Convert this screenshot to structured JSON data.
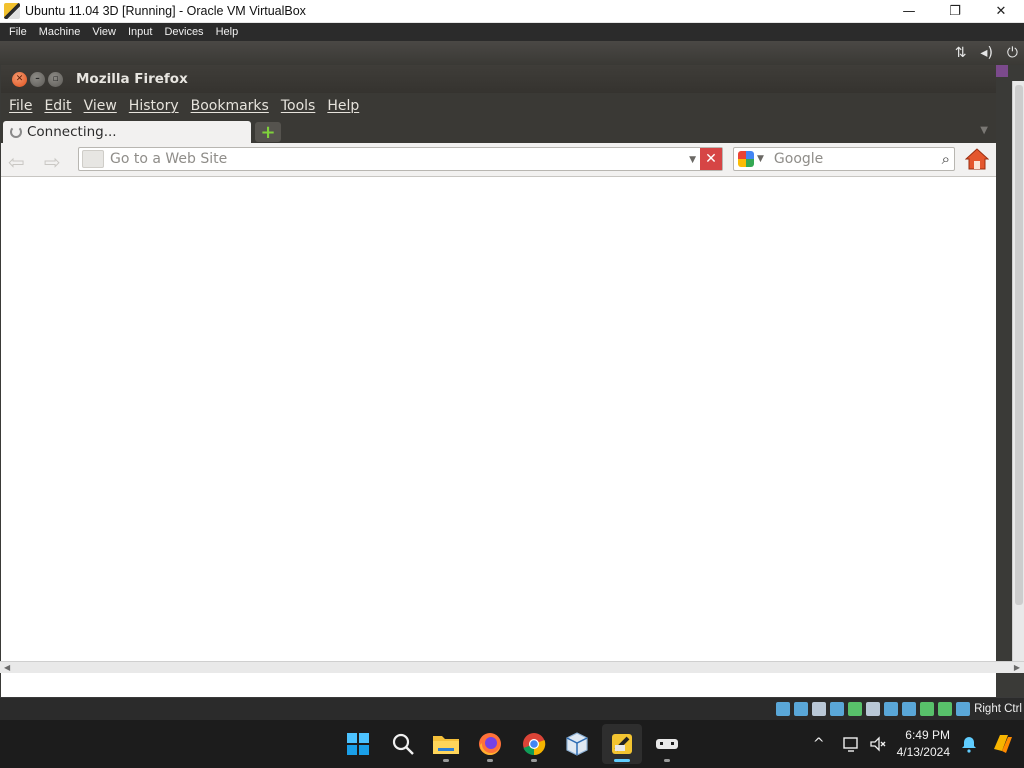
{
  "vbox": {
    "title": "Ubuntu 11.04 3D [Running] - Oracle VM VirtualBox",
    "menu": [
      "File",
      "Machine",
      "View",
      "Input",
      "Devices",
      "Help"
    ],
    "window_controls": {
      "minimize": "—",
      "maximize": "❐",
      "close": "✕"
    },
    "status": {
      "host_key": "Right Ctrl"
    }
  },
  "guest_topbar": {
    "icons": {
      "network": "⇅",
      "volume": "◂)",
      "power": "⏻"
    }
  },
  "firefox": {
    "title": "Mozilla Firefox",
    "menu": [
      "File",
      "Edit",
      "View",
      "History",
      "Bookmarks",
      "Tools",
      "Help"
    ],
    "tab": {
      "label": "Connecting..."
    },
    "new_tab_symbol": "+",
    "nav": {
      "back": "⇦",
      "forward": "⇨"
    },
    "url": {
      "placeholder": "Go to a Web Site",
      "value": ""
    },
    "stop_symbol": "✕",
    "search": {
      "placeholder": "Google",
      "value": ""
    },
    "search_symbol": "⌕"
  },
  "taskbar": {
    "tray_chevron": "^",
    "clock": {
      "time": "6:49 PM",
      "date": "4/13/2024"
    }
  },
  "colors": {
    "ubuntu_dark": "#3a3935",
    "stop_red": "#d64545",
    "taskbar": "#1c1c1c",
    "accent_blue": "#60cdff"
  }
}
